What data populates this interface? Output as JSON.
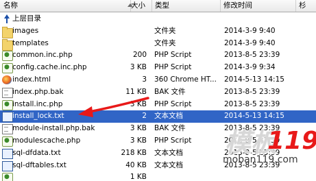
{
  "columns": {
    "name": "名称",
    "size": "大小",
    "type": "类型",
    "modified": "修改时间",
    "extra": "杉"
  },
  "up_row": {
    "label": "上层目录",
    "icon": "up-arrow-icon"
  },
  "rows": [
    {
      "name": "images",
      "size": "",
      "type": "文件夹",
      "modified": "2014-3-9 9:40",
      "icon": "folder-icon"
    },
    {
      "name": "templates",
      "size": "",
      "type": "文件夹",
      "modified": "2014-3-9 9:40",
      "icon": "folder-icon"
    },
    {
      "name": "common.inc.php",
      "size": "200",
      "type": "PHP Script",
      "modified": "2013-8-5 23:39",
      "icon": "php-file-icon"
    },
    {
      "name": "config.cache.inc.php",
      "size": "3 KB",
      "type": "PHP Script",
      "modified": "2014-3-9 9:34",
      "icon": "php-file-icon"
    },
    {
      "name": "index.html",
      "size": "3",
      "type": "360 Chrome HT...",
      "modified": "2014-5-13 14:15",
      "icon": "html-file-icon"
    },
    {
      "name": "index.php.bak",
      "size": "11 KB",
      "type": "BAK 文件",
      "modified": "2013-8-5 23:39",
      "icon": "bak-file-icon"
    },
    {
      "name": "install.inc.php",
      "size": "3 KB",
      "type": "PHP Script",
      "modified": "2013-8-5 23:39",
      "icon": "php-file-icon"
    },
    {
      "name": "install_lock.txt",
      "size": "2",
      "type": "文本文档",
      "modified": "2014-5-13 14:15",
      "icon": "text-file-icon",
      "selected": true
    },
    {
      "name": "module-install.php.bak",
      "size": "3 KB",
      "type": "BAK 文件",
      "modified": "2013-8-5 23:39",
      "icon": "bak-file-icon"
    },
    {
      "name": "modulescache.php",
      "size": "3 KB",
      "type": "PHP Script",
      "modified": "2013-8-5 23:39",
      "icon": "php-file-icon"
    },
    {
      "name": "sql-dfdata.txt",
      "size": "218 KB",
      "type": "文本文档",
      "modified": "2013-8-5 23:39",
      "icon": "text-file-icon"
    },
    {
      "name": "sql-dftables.txt",
      "size": "40 KB",
      "type": "文本文档",
      "modified": "2013-8-5 23:39",
      "icon": "text-file-icon"
    },
    {
      "name": "",
      "size": "1 KB",
      "type": "",
      "modified": "",
      "icon": "php-file-icon"
    }
  ],
  "watermark": {
    "brand_cn": "模板",
    "brand_num": "119",
    "url": "moban119.com"
  },
  "colors": {
    "selection": "#3165c6",
    "arrow": "#e81919",
    "header_bg": "#efefef"
  }
}
